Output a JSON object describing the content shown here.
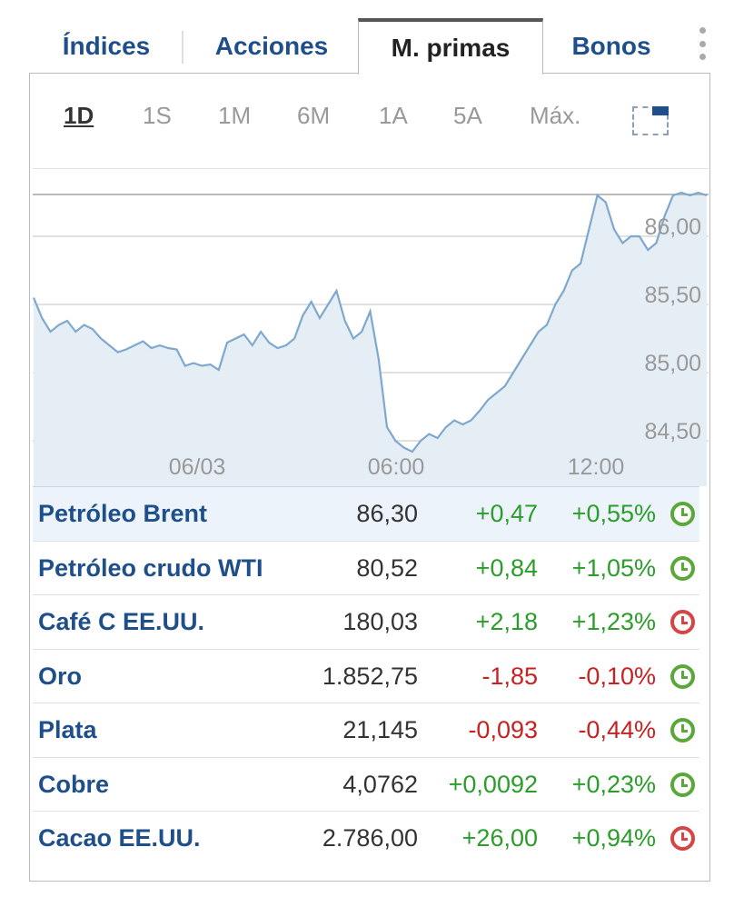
{
  "tabs": {
    "indices": "Índices",
    "acciones": "Acciones",
    "materias_primas": "M. primas",
    "bonos": "Bonos",
    "active": "M. primas"
  },
  "range_selector": {
    "options": [
      "1D",
      "1S",
      "1M",
      "6M",
      "1A",
      "5A",
      "Máx."
    ],
    "active": "1D"
  },
  "chart_data": {
    "type": "area",
    "series_name": "Petróleo Brent",
    "x_ticks": [
      "06/03",
      "06:00",
      "12:00"
    ],
    "y_ticks": [
      "84,50",
      "85,00",
      "85,50",
      "86,00"
    ],
    "ylim": [
      84.4,
      86.35
    ],
    "reference_value": 86.3,
    "values": [
      85.55,
      85.4,
      85.3,
      85.35,
      85.38,
      85.3,
      85.35,
      85.32,
      85.25,
      85.2,
      85.15,
      85.17,
      85.2,
      85.23,
      85.18,
      85.2,
      85.18,
      85.17,
      85.05,
      85.07,
      85.05,
      85.06,
      85.02,
      85.22,
      85.25,
      85.28,
      85.2,
      85.3,
      85.22,
      85.18,
      85.2,
      85.25,
      85.42,
      85.52,
      85.4,
      85.5,
      85.6,
      85.38,
      85.25,
      85.3,
      85.45,
      85.1,
      84.6,
      84.5,
      84.45,
      84.42,
      84.5,
      84.55,
      84.52,
      84.6,
      84.65,
      84.62,
      84.65,
      84.72,
      84.8,
      84.85,
      84.9,
      85.0,
      85.1,
      85.2,
      85.3,
      85.35,
      85.5,
      85.6,
      85.75,
      85.8,
      86.05,
      86.3,
      86.25,
      86.05,
      85.95,
      86.0,
      86.0,
      85.9,
      85.95,
      86.15,
      86.3,
      86.32,
      86.3,
      86.32,
      86.3
    ],
    "grid": true
  },
  "instruments": [
    {
      "name": "Petróleo Brent",
      "price": "86,30",
      "change": "+0,47",
      "pct": "+0,55%",
      "dir": "pos",
      "market": "open"
    },
    {
      "name": "Petróleo crudo WTI",
      "price": "80,52",
      "change": "+0,84",
      "pct": "+1,05%",
      "dir": "pos",
      "market": "open"
    },
    {
      "name": "Café C EE.UU.",
      "price": "180,03",
      "change": "+2,18",
      "pct": "+1,23%",
      "dir": "pos",
      "market": "closed"
    },
    {
      "name": "Oro",
      "price": "1.852,75",
      "change": "-1,85",
      "pct": "-0,10%",
      "dir": "neg",
      "market": "open"
    },
    {
      "name": "Plata",
      "price": "21,145",
      "change": "-0,093",
      "pct": "-0,44%",
      "dir": "neg",
      "market": "open"
    },
    {
      "name": "Cobre",
      "price": "4,0762",
      "change": "+0,0092",
      "pct": "+0,23%",
      "dir": "pos",
      "market": "open"
    },
    {
      "name": "Cacao EE.UU.",
      "price": "2.786,00",
      "change": "+26,00",
      "pct": "+0,94%",
      "dir": "pos",
      "market": "closed"
    }
  ],
  "colors": {
    "link": "#1e4f8a",
    "positive": "#2a9d2a",
    "negative": "#c82121",
    "chart_line": "#7fa8cf",
    "chart_fill": "#e6eef5",
    "market_open": "#5aa83a",
    "market_closed": "#d64545"
  }
}
